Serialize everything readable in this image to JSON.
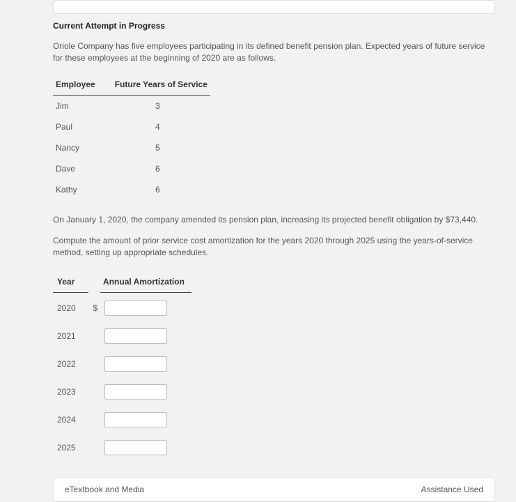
{
  "heading": "Current Attempt in Progress",
  "intro": "Oriole Company has five employees participating in its defined benefit pension plan. Expected years of future service for these employees at the beginning of 2020 are as follows.",
  "emp_table": {
    "col1": "Employee",
    "col2": "Future Years of Service",
    "rows": [
      {
        "name": "Jim",
        "years": "3"
      },
      {
        "name": "Paul",
        "years": "4"
      },
      {
        "name": "Nancy",
        "years": "5"
      },
      {
        "name": "Dave",
        "years": "6"
      },
      {
        "name": "Kathy",
        "years": "6"
      }
    ]
  },
  "mid_text": "On January 1, 2020, the company amended its pension plan, increasing its projected benefit obligation by $73,440.",
  "instruction": "Compute the amount of prior service cost amortization for the years 2020 through 2025 using the years-of-service method, setting up appropriate schedules.",
  "amort_table": {
    "col1": "Year",
    "col2": "Annual Amortization",
    "currency": "$",
    "rows": [
      {
        "year": "2020",
        "show_sym": true
      },
      {
        "year": "2021",
        "show_sym": false
      },
      {
        "year": "2022",
        "show_sym": false
      },
      {
        "year": "2023",
        "show_sym": false
      },
      {
        "year": "2024",
        "show_sym": false
      },
      {
        "year": "2025",
        "show_sym": false
      }
    ]
  },
  "footer": {
    "left": "eTextbook and Media",
    "right": "Assistance Used"
  }
}
